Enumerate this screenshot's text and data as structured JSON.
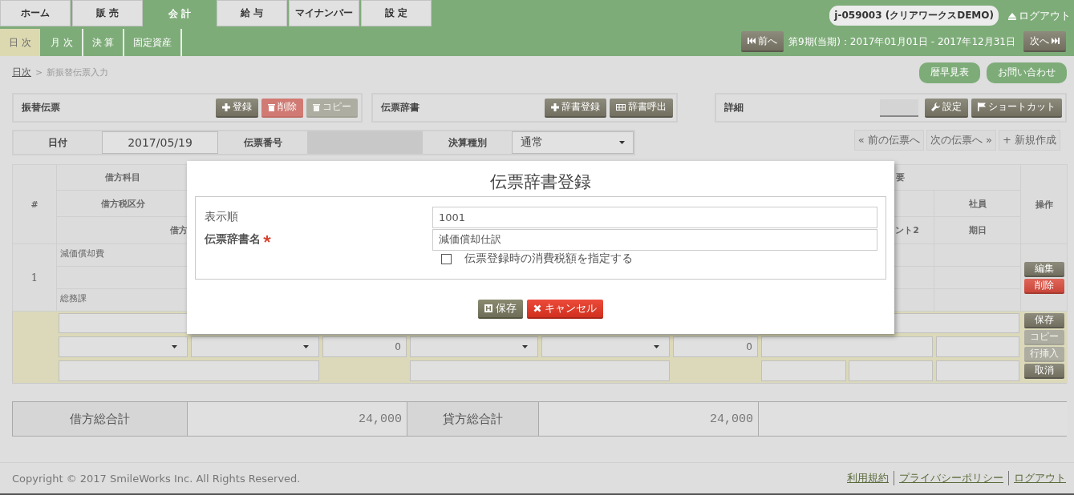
{
  "top_tabs": [
    {
      "label": "ホーム",
      "selected": false
    },
    {
      "label": "販 売",
      "selected": false
    },
    {
      "label": "会 計",
      "selected": true
    },
    {
      "label": "給 与",
      "selected": false
    },
    {
      "label": "マイナンバー",
      "selected": false
    },
    {
      "label": "設 定",
      "selected": false
    }
  ],
  "user": {
    "account": "j-059003 (クリアワークスDEMO)",
    "logout": "ログアウト"
  },
  "sub_tabs": [
    {
      "label": "日 次",
      "selected": true
    },
    {
      "label": "月 次",
      "selected": false
    },
    {
      "label": "決 算",
      "selected": false
    },
    {
      "label": "固定資産",
      "selected": false
    }
  ],
  "period": {
    "prev": "前へ",
    "label": "第9期(当期)：2017年01月01日 - 2017年12月31日",
    "next": "次へ"
  },
  "breadcrumb": {
    "link": "日次",
    "separator": ">",
    "current": "新振替伝票入力"
  },
  "top_links": [
    "暦早見表",
    "お問い合わせ"
  ],
  "panels": [
    {
      "title": "振替伝票",
      "blank_box": false,
      "buttons": [
        {
          "label": "登録",
          "kind": "dark",
          "disabled": false
        },
        {
          "label": "削除",
          "kind": "danger",
          "disabled": true
        },
        {
          "label": "コピー",
          "kind": "dark",
          "disabled": true
        }
      ]
    },
    {
      "title": "伝票辞書",
      "blank_box": false,
      "buttons": [
        {
          "label": "辞書登録",
          "kind": "dark",
          "disabled": false
        },
        {
          "label": "辞書呼出",
          "kind": "dark",
          "disabled": false
        }
      ]
    },
    {
      "title": "詳細",
      "blank_box": true,
      "buttons": [
        {
          "label": "設定",
          "kind": "dark",
          "disabled": false
        },
        {
          "label": "ショートカット",
          "kind": "dark",
          "disabled": false
        }
      ]
    }
  ],
  "voucher_form": {
    "date_label": "日付",
    "date": "2017/05/19",
    "number_label": "伝票番号",
    "type_label": "決算種別",
    "type": "通常"
  },
  "nav_buttons": [
    "« 前の伝票へ",
    "次の伝票へ »",
    "+ 新規作成"
  ],
  "table": {
    "columns": {
      "number": "#",
      "debit_account": "借方科目",
      "debit_tax": "借方税区分",
      "column_3": "借方",
      "column_4": "要",
      "column_5": "社員",
      "column_6": "ント2",
      "column_7": "期日",
      "actions": "操作"
    },
    "rows": [
      {
        "number": "1",
        "account": "減価償却費",
        "department": "総務課",
        "actions": [
          {
            "label": "編集",
            "kind": "dark",
            "disabled": false
          },
          {
            "label": "削除",
            "kind": "danger",
            "disabled": false
          }
        ]
      }
    ],
    "edit_row": {
      "debit_amount": "0",
      "credit_amount": "0",
      "actions": [
        {
          "label": "保存",
          "disabled": false
        },
        {
          "label": "コピー",
          "disabled": true
        },
        {
          "label": "行挿入",
          "disabled": true
        },
        {
          "label": "取消",
          "disabled": false
        }
      ]
    }
  },
  "totals": {
    "debit_label": "借方総合計",
    "debit": "24,000",
    "credit_label": "貸方総合計",
    "credit": "24,000"
  },
  "footer": {
    "copyright": "Copyright © 2017 SmileWorks Inc. All Rights Reserved.",
    "links": [
      "利用規約",
      "プライバシーポリシー",
      "ログアウト"
    ]
  },
  "dialog": {
    "title": "伝票辞書登録",
    "fields": [
      {
        "label": "表示順",
        "value": "1001",
        "required": false
      },
      {
        "label": "伝票辞書名",
        "value": "減価償却仕訳",
        "required": true
      }
    ],
    "checkbox": {
      "label": "伝票登録時の消費税額を指定する",
      "checked": false
    },
    "buttons": [
      {
        "label": "保存",
        "kind": "save"
      },
      {
        "label": "キャンセル",
        "kind": "cancel"
      }
    ]
  }
}
